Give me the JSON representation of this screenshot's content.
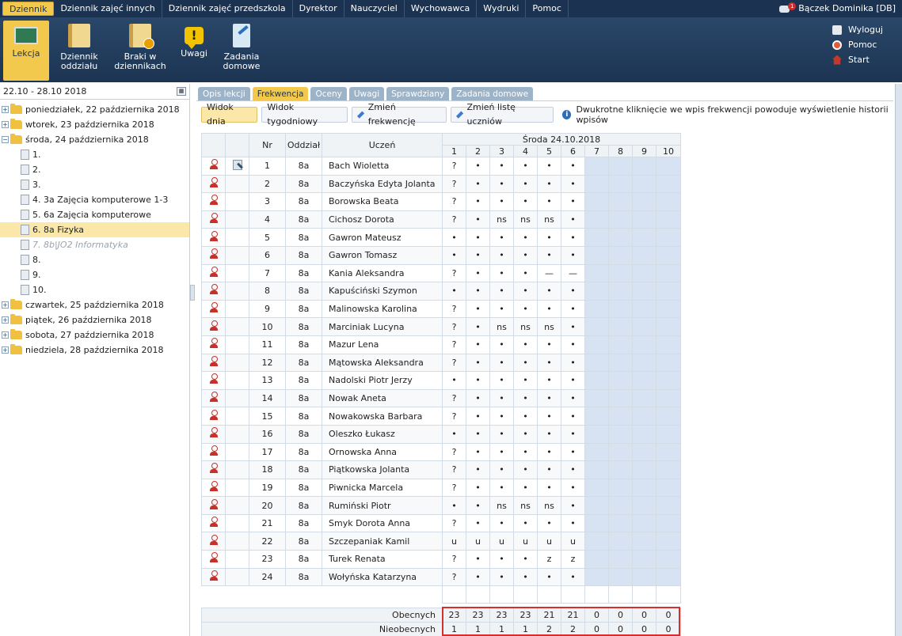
{
  "menu": {
    "items": [
      "Dziennik",
      "Dziennik zajęć innych",
      "Dziennik zajęć przedszkola",
      "Dyrektor",
      "Nauczyciel",
      "Wychowawca",
      "Wydruki",
      "Pomoc"
    ],
    "message_badge": "1",
    "user": "Bączek Dominika [DB]"
  },
  "toolbar": {
    "lekcja": "Lekcja",
    "dziennik_oddzialu": [
      "Dziennik",
      "oddziału"
    ],
    "braki": [
      "Braki w",
      "dziennikach"
    ],
    "uwagi": "Uwagi",
    "zadania": [
      "Zadania",
      "domowe"
    ],
    "wyloguj": "Wyloguj",
    "pomoc": "Pomoc",
    "start": "Start"
  },
  "left": {
    "date_range": "22.10 - 28.10 2018",
    "tree": [
      {
        "label": "poniedziałek, 22 października 2018",
        "type": "folder",
        "exp": "+"
      },
      {
        "label": "wtorek, 23 października 2018",
        "type": "folder",
        "exp": "+"
      },
      {
        "label": "środa, 24 października 2018",
        "type": "folder",
        "exp": "−"
      },
      {
        "label": "1.",
        "type": "doc"
      },
      {
        "label": "2.",
        "type": "doc"
      },
      {
        "label": "3.",
        "type": "doc"
      },
      {
        "label": "4. 3a Zajęcia komputerowe 1-3",
        "type": "doc"
      },
      {
        "label": "5. 6a Zajęcia komputerowe",
        "type": "doc"
      },
      {
        "label": "6. 8a Fizyka",
        "type": "doc",
        "selected": true
      },
      {
        "label": "7. 8b|JO2 Informatyka",
        "type": "doc",
        "dim": true
      },
      {
        "label": "8.",
        "type": "doc"
      },
      {
        "label": "9.",
        "type": "doc"
      },
      {
        "label": "10.",
        "type": "doc"
      },
      {
        "label": "czwartek, 25 października 2018",
        "type": "folder",
        "exp": "+"
      },
      {
        "label": "piątek, 26 października 2018",
        "type": "folder",
        "exp": "+"
      },
      {
        "label": "sobota, 27 października 2018",
        "type": "folder",
        "exp": "+"
      },
      {
        "label": "niedziela, 28 października 2018",
        "type": "folder",
        "exp": "+"
      }
    ]
  },
  "tabs": [
    "Opis lekcji",
    "Frekwencja",
    "Oceny",
    "Uwagi",
    "Sprawdziany",
    "Zadania domowe"
  ],
  "subbar": {
    "widok_dnia": "Widok dnia",
    "widok_tyg": "Widok tygodniowy",
    "zmien_frek": "Zmień frekwencję",
    "zmien_liste": "Zmień listę uczniów",
    "info": "Dwukrotne kliknięcie we wpis frekwencji powoduje wyświetlenie historii wpisów"
  },
  "grid": {
    "col_nr": "Nr",
    "col_oddzial": "Oddział",
    "col_uczen": "Uczeń",
    "day_header": "Środa 24.10.2018",
    "lessons": [
      "1",
      "2",
      "3",
      "4",
      "5",
      "6",
      "7",
      "8",
      "9",
      "10"
    ],
    "students": [
      {
        "nr": "1",
        "o": "8a",
        "name": "Bach Wioletta",
        "att": [
          "?",
          "•",
          "•",
          "•",
          "•",
          "•"
        ]
      },
      {
        "nr": "2",
        "o": "8a",
        "name": "Baczyńska Edyta Jolanta",
        "att": [
          "?",
          "•",
          "•",
          "•",
          "•",
          "•"
        ]
      },
      {
        "nr": "3",
        "o": "8a",
        "name": "Borowska Beata",
        "att": [
          "?",
          "•",
          "•",
          "•",
          "•",
          "•"
        ]
      },
      {
        "nr": "4",
        "o": "8a",
        "name": "Cichosz Dorota",
        "att": [
          "?",
          "•",
          "ns",
          "ns",
          "ns",
          "•"
        ]
      },
      {
        "nr": "5",
        "o": "8a",
        "name": "Gawron Mateusz",
        "att": [
          "•",
          "•",
          "•",
          "•",
          "•",
          "•"
        ]
      },
      {
        "nr": "6",
        "o": "8a",
        "name": "Gawron Tomasz",
        "att": [
          "•",
          "•",
          "•",
          "•",
          "•",
          "•"
        ]
      },
      {
        "nr": "7",
        "o": "8a",
        "name": "Kania Aleksandra",
        "att": [
          "?",
          "•",
          "•",
          "•",
          "—",
          "—"
        ]
      },
      {
        "nr": "8",
        "o": "8a",
        "name": "Kapuściński Szymon",
        "att": [
          "•",
          "•",
          "•",
          "•",
          "•",
          "•"
        ]
      },
      {
        "nr": "9",
        "o": "8a",
        "name": "Malinowska Karolina",
        "att": [
          "?",
          "•",
          "•",
          "•",
          "•",
          "•"
        ]
      },
      {
        "nr": "10",
        "o": "8a",
        "name": "Marciniak Lucyna",
        "att": [
          "?",
          "•",
          "ns",
          "ns",
          "ns",
          "•"
        ]
      },
      {
        "nr": "11",
        "o": "8a",
        "name": "Mazur Lena",
        "att": [
          "?",
          "•",
          "•",
          "•",
          "•",
          "•"
        ]
      },
      {
        "nr": "12",
        "o": "8a",
        "name": "Mątowska Aleksandra",
        "att": [
          "?",
          "•",
          "•",
          "•",
          "•",
          "•"
        ]
      },
      {
        "nr": "13",
        "o": "8a",
        "name": "Nadolski Piotr Jerzy",
        "att": [
          "•",
          "•",
          "•",
          "•",
          "•",
          "•"
        ]
      },
      {
        "nr": "14",
        "o": "8a",
        "name": "Nowak Aneta",
        "att": [
          "?",
          "•",
          "•",
          "•",
          "•",
          "•"
        ]
      },
      {
        "nr": "15",
        "o": "8a",
        "name": "Nowakowska Barbara",
        "att": [
          "?",
          "•",
          "•",
          "•",
          "•",
          "•"
        ]
      },
      {
        "nr": "16",
        "o": "8a",
        "name": "Oleszko Łukasz",
        "att": [
          "•",
          "•",
          "•",
          "•",
          "•",
          "•"
        ]
      },
      {
        "nr": "17",
        "o": "8a",
        "name": "Ornowska Anna",
        "att": [
          "?",
          "•",
          "•",
          "•",
          "•",
          "•"
        ]
      },
      {
        "nr": "18",
        "o": "8a",
        "name": "Piątkowska Jolanta",
        "att": [
          "?",
          "•",
          "•",
          "•",
          "•",
          "•"
        ]
      },
      {
        "nr": "19",
        "o": "8a",
        "name": "Piwnicka Marcela",
        "att": [
          "?",
          "•",
          "•",
          "•",
          "•",
          "•"
        ]
      },
      {
        "nr": "20",
        "o": "8a",
        "name": "Rumiński Piotr",
        "att": [
          "•",
          "•",
          "ns",
          "ns",
          "ns",
          "•"
        ]
      },
      {
        "nr": "21",
        "o": "8a",
        "name": "Smyk Dorota Anna",
        "att": [
          "?",
          "•",
          "•",
          "•",
          "•",
          "•"
        ]
      },
      {
        "nr": "22",
        "o": "8a",
        "name": "Szczepaniak Kamil",
        "att": [
          "u",
          "u",
          "u",
          "u",
          "u",
          "u"
        ]
      },
      {
        "nr": "23",
        "o": "8a",
        "name": "Turek Renata",
        "att": [
          "?",
          "•",
          "•",
          "•",
          "z",
          "z"
        ]
      },
      {
        "nr": "24",
        "o": "8a",
        "name": "Wołyńska Katarzyna",
        "att": [
          "?",
          "•",
          "•",
          "•",
          "•",
          "•"
        ]
      }
    ]
  },
  "summary": {
    "obecnych_label": "Obecnych",
    "nieobecnych_label": "Nieobecnych",
    "obecnych": [
      "23",
      "23",
      "23",
      "23",
      "21",
      "21",
      "0",
      "0",
      "0",
      "0"
    ],
    "nieobecnych": [
      "1",
      "1",
      "1",
      "1",
      "2",
      "2",
      "0",
      "0",
      "0",
      "0"
    ]
  },
  "colors": {
    "accent": "#f2c94c",
    "navy": "#1b3350",
    "highlight_border": "#d43030",
    "empty_cell": "#d7e3f3"
  }
}
